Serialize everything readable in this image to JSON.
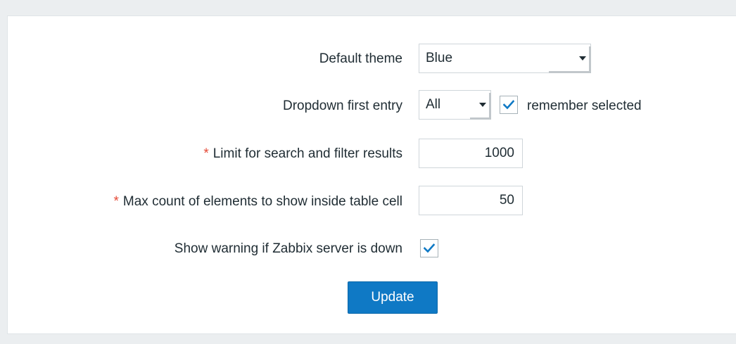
{
  "form": {
    "default_theme": {
      "label": "Default theme",
      "value": "Blue"
    },
    "dropdown_first_entry": {
      "label": "Dropdown first entry",
      "value": "All",
      "remember_label": "remember selected",
      "remember_checked": true
    },
    "search_limit": {
      "required_mark": "*",
      "label": "Limit for search and filter results",
      "value": "1000"
    },
    "max_count": {
      "required_mark": "*",
      "label": "Max count of elements to show inside table cell",
      "value": "50"
    },
    "server_warning": {
      "label": "Show warning if Zabbix server is down",
      "checked": true
    },
    "update_button": "Update"
  },
  "colors": {
    "background": "#ebeef0",
    "panel": "#ffffff",
    "accent": "#0f79c5",
    "required": "#e54936",
    "check": "#0f79c5"
  }
}
